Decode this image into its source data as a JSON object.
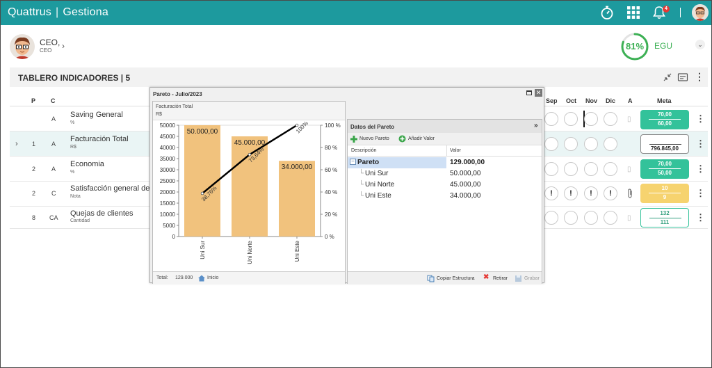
{
  "topbar": {
    "brand": "Quattrus",
    "product": "Gestiona",
    "notifications": "4"
  },
  "user": {
    "name": "CEO,",
    "role": "CEO"
  },
  "score": {
    "percent": "81%",
    "label": "EGU",
    "fraction": 0.81,
    "color": "#3cb054"
  },
  "section": {
    "title": "TABLERO INDICADORES | 5"
  },
  "table": {
    "headers": {
      "p": "P",
      "c": "C",
      "sep": "Sep",
      "oct": "Oct",
      "nov": "Nov",
      "dic": "Dic",
      "a": "A",
      "meta": "Meta"
    },
    "rows": [
      {
        "p": "",
        "c": "A",
        "name": "Saving General",
        "unit": "%",
        "meta_a": "70,00",
        "meta_b": "60,00"
      },
      {
        "p": "1",
        "c": "A",
        "name": "Facturación Total",
        "unit": "R$",
        "meta_a": "",
        "meta_b": "796.845,00"
      },
      {
        "p": "2",
        "c": "A",
        "name": "Economia",
        "unit": "%",
        "meta_a": "70,00",
        "meta_b": "50,00"
      },
      {
        "p": "2",
        "c": "C",
        "name": "Satisfacción general de cl",
        "unit": "Nota",
        "meta_a": "10",
        "meta_b": "9"
      },
      {
        "p": "8",
        "c": "CA",
        "name": "Quejas de clientes",
        "unit": "Cantidad",
        "meta_a": "132",
        "meta_b": "111"
      }
    ]
  },
  "popup": {
    "title": "Pareto - Julio/2023",
    "chart_title": "Facturación Total",
    "chart_unit": "R$",
    "footer_total_label": "Total:",
    "footer_total_value": "129.000",
    "footer_home": "Inicio"
  },
  "chart_data": {
    "type": "bar",
    "title": "Facturación Total",
    "subtitle": "R$",
    "categories": [
      "Uni Sur",
      "Uni Norte",
      "Uni Este"
    ],
    "values": [
      50000,
      45000,
      34000
    ],
    "value_labels": [
      "50.000,00",
      "45.000,00",
      "34.000,00"
    ],
    "cumulative_percent": [
      38.76,
      73.64,
      100
    ],
    "cumulative_labels": [
      "38,76%",
      "73,64%",
      "100%"
    ],
    "ylim": [
      0,
      50000
    ],
    "y_ticks": [
      "0",
      "5000",
      "10000",
      "15000",
      "20000",
      "25000",
      "30000",
      "35000",
      "40000",
      "45000",
      "50000"
    ],
    "y2_ticks": [
      "0 %",
      "20 %",
      "40 %",
      "60 %",
      "80 %",
      "100 %"
    ],
    "bar_color": "#f1c27d",
    "line_color": "#000000"
  },
  "pareto_data": {
    "title": "Datos del Pareto",
    "new_label": "Nuevo Pareto",
    "add_label": "Añadir Valor",
    "col_desc": "Descripción",
    "col_value": "Valor",
    "root": {
      "desc": "Pareto",
      "value": "129.000,00"
    },
    "items": [
      {
        "desc": "Uni Sur",
        "value": "50.000,00"
      },
      {
        "desc": "Uni Norte",
        "value": "45.000,00"
      },
      {
        "desc": "Uni Este",
        "value": "34.000,00"
      }
    ],
    "copy_label": "Copiar Estructura",
    "remove_label": "Retirar",
    "save_label": "Grabar"
  }
}
